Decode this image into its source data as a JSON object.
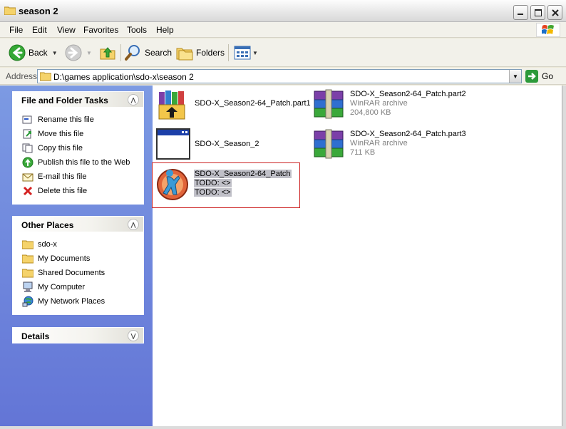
{
  "window": {
    "title": "season 2"
  },
  "menu": [
    "File",
    "Edit",
    "View",
    "Favorites",
    "Tools",
    "Help"
  ],
  "toolbar": {
    "back_label": "Back",
    "search_label": "Search",
    "folders_label": "Folders"
  },
  "address": {
    "label": "Address",
    "path": "D:\\games application\\sdo-x\\season 2",
    "go_label": "Go"
  },
  "tasks_panel": {
    "title": "File and Folder Tasks",
    "items": [
      {
        "label": "Rename this file",
        "icon": "rename-icon"
      },
      {
        "label": "Move this file",
        "icon": "move-icon"
      },
      {
        "label": "Copy this file",
        "icon": "copy-icon"
      },
      {
        "label": "Publish this file to the Web",
        "icon": "publish-icon"
      },
      {
        "label": "E-mail this file",
        "icon": "email-icon"
      },
      {
        "label": "Delete this file",
        "icon": "delete-icon"
      }
    ]
  },
  "places_panel": {
    "title": "Other Places",
    "items": [
      {
        "label": "sdo-x",
        "icon": "folder-icon"
      },
      {
        "label": "My Documents",
        "icon": "folder-icon"
      },
      {
        "label": "Shared Documents",
        "icon": "folder-icon"
      },
      {
        "label": "My Computer",
        "icon": "computer-icon"
      },
      {
        "label": "My Network Places",
        "icon": "network-icon"
      }
    ]
  },
  "details_panel": {
    "title": "Details"
  },
  "files": [
    {
      "name": "SDO-X_Season2-64_Patch.part1",
      "line2": "",
      "line3": "",
      "icon": "installer-icon"
    },
    {
      "name": "SDO-X_Season2-64_Patch.part2",
      "line2": "WinRAR archive",
      "line3": "204,800 KB",
      "icon": "winrar-icon"
    },
    {
      "name": "SDO-X_Season_2",
      "line2": "",
      "line3": "",
      "icon": "window-app-icon"
    },
    {
      "name": "SDO-X_Season2-64_Patch.part3",
      "line2": "WinRAR archive",
      "line3": "711 KB",
      "icon": "winrar-icon"
    },
    {
      "name": "SDO-X_Season2-64_Patch",
      "line2": "TODO: <>",
      "line3": "TODO: <>",
      "icon": "game-dancer-icon"
    }
  ],
  "colors": {
    "sidebar_top": "#7c9ae3",
    "sidebar_bottom": "#6375d6",
    "selection_outline": "#cc2222",
    "selection_fill": "#c0c0c8",
    "go_green": "#2c9a3a"
  }
}
